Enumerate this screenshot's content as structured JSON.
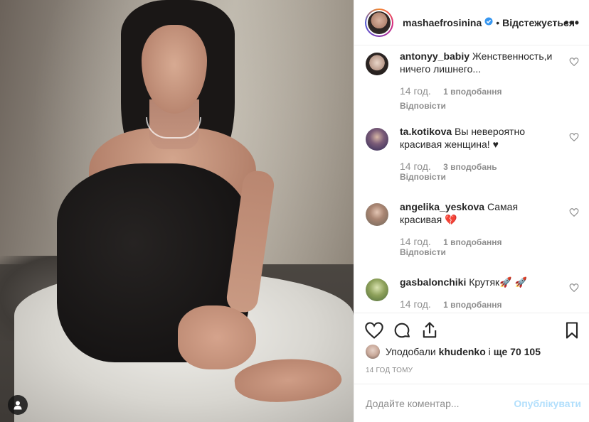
{
  "post": {
    "owner": "mashaefrosinina",
    "follow_status": "Відстежується",
    "separator": "•",
    "more_label": "•••"
  },
  "comments": [
    {
      "user": "antonyy_babiy",
      "text": "Женственность,и ничего лишнего...",
      "time": "14 год.",
      "likes": "1 вподобання",
      "reply": "Відповісти"
    },
    {
      "user": "ta.kotikova",
      "text": "Вы невероятно красивая женщина! ♥",
      "time": "14 год.",
      "likes": "3 вподобань",
      "reply": "Відповісти"
    },
    {
      "user": "angelika_yeskova",
      "text": "Самая красивая 💔",
      "time": "14 год.",
      "likes": "1 вподобання",
      "reply": "Відповісти"
    },
    {
      "user": "gasbalonchiki",
      "text": "Крутяк🚀 🚀",
      "time": "14 год.",
      "likes": "1 вподобання"
    }
  ],
  "likes": {
    "prefix": "Уподобали",
    "user": "khudenko",
    "middle": "і",
    "rest": "ще 70 105"
  },
  "time_ago": "14 ГОД ТОМУ",
  "comment_box": {
    "placeholder": "Додайте коментар...",
    "publish": "Опублікувати"
  },
  "icons": [
    "user-tag-icon",
    "verified-icon",
    "heart-icon",
    "comment-icon",
    "share-icon",
    "bookmark-icon"
  ],
  "colors": {
    "link": "#3897f0",
    "publish_disabled": "#b2dffc",
    "muted": "#8e8e8e",
    "text": "#262626"
  }
}
